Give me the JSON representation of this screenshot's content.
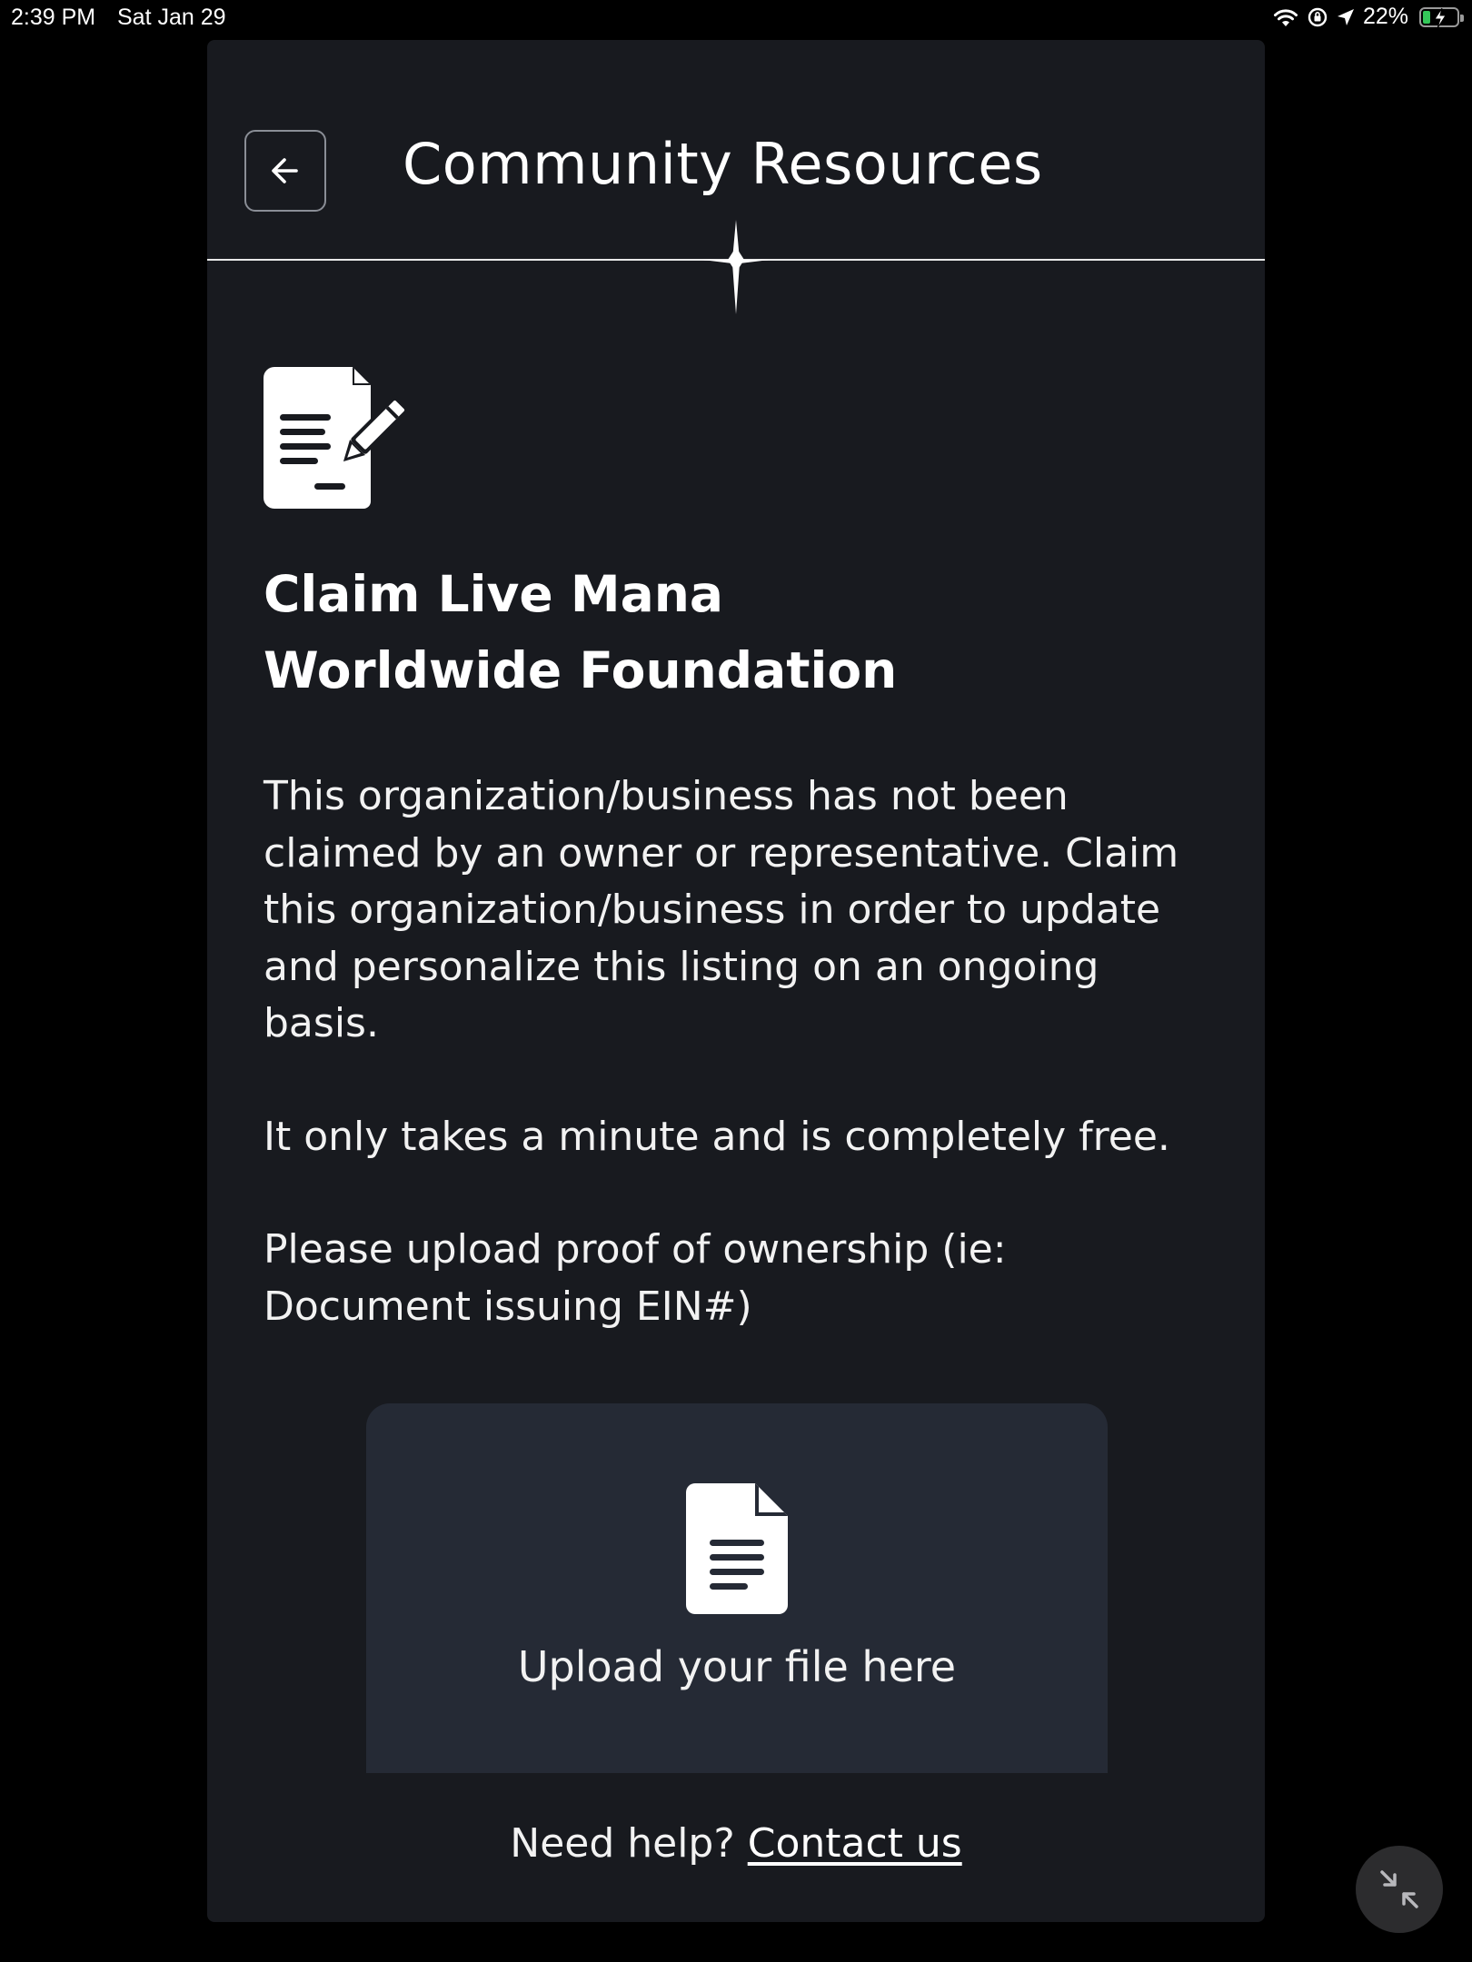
{
  "status_bar": {
    "time": "2:39 PM",
    "date": "Sat Jan 29",
    "battery_percent": "22%",
    "battery_level": 0.22,
    "charging": true,
    "icons": [
      "wifi-icon",
      "orientation-lock-icon",
      "location-icon",
      "battery-icon"
    ]
  },
  "header": {
    "title": "Community Resources",
    "back_icon": "arrow-left-icon",
    "divider_ornament": "sparkle-icon"
  },
  "claim": {
    "icon": "document-signature-icon",
    "title_line1": "Claim Live Mana",
    "title_line2": "Worldwide Foundation",
    "paragraph1": "This organization/business has not been claimed by an owner or representative. Claim this organization/business in order to update and personalize this listing on an ongoing basis.",
    "paragraph2": "It only takes a minute and is completely free.",
    "paragraph3": "Please upload proof of ownership (ie: Document issuing EIN#)"
  },
  "upload": {
    "icon": "file-text-icon",
    "label": "Upload your file here"
  },
  "help": {
    "prefix": "Need help?",
    "link": "Contact us"
  },
  "floating": {
    "icon": "minimize-arrows-icon"
  },
  "colors": {
    "background": "#000000",
    "panel": "#181a1f",
    "upload_box": "#252a35",
    "text": "#ffffff",
    "battery": "#34c759"
  }
}
